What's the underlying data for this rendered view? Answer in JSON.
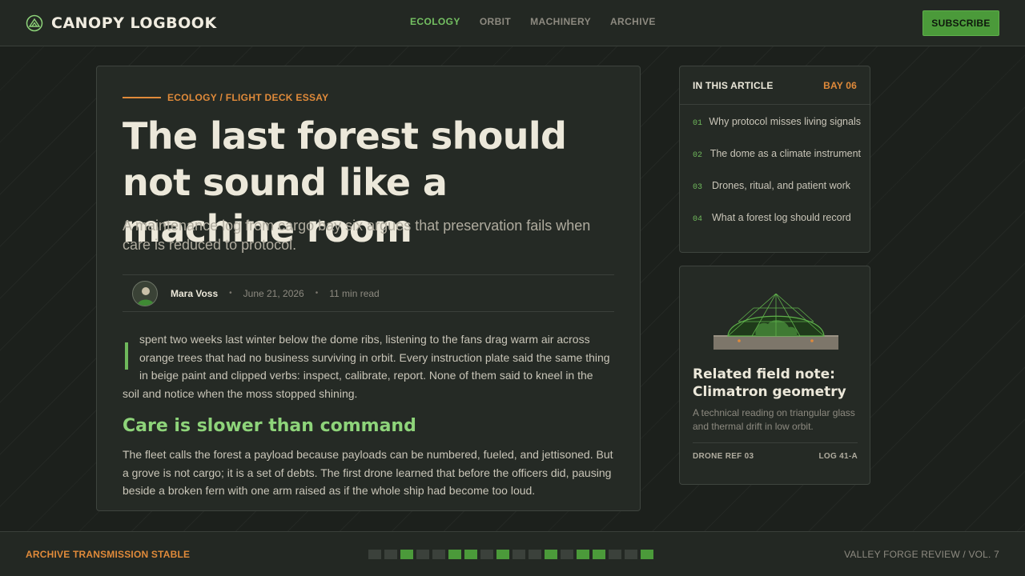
{
  "header": {
    "brand": "CANOPY LOGBOOK",
    "brand_icon": "canopy-logo-icon",
    "nav": [
      {
        "label": "ECOLOGY",
        "active": true
      },
      {
        "label": "ORBIT",
        "active": false
      },
      {
        "label": "MACHINERY",
        "active": false
      },
      {
        "label": "ARCHIVE",
        "active": false
      }
    ],
    "subscribe_label": "SUBSCRIBE"
  },
  "article": {
    "kicker": "ECOLOGY / FLIGHT DECK ESSAY",
    "headline": "The last forest should not sound like a machine room",
    "dek": "A maintenance log from cargo bay six argues that preservation fails when care is reduced to protocol.",
    "author": "Mara Voss",
    "date": "June 21, 2026",
    "read_time": "11 min read",
    "separator": "•",
    "lead_paragraph": "I spent two weeks last winter below the dome ribs, listening to the fans drag warm air across orange trees that had no business surviving in orbit. Every instruction plate said the same thing in beige paint and clipped verbs: inspect, calibrate, report. None of them said to kneel in the soil and notice when the moss stopped shining.",
    "subhead": "Care is slower than command",
    "second_paragraph": "The fleet calls the forest a payload because payloads can be numbered, fueled, and jettisoned. But a grove is not cargo; it is a set of debts. The first drone learned that before the officers did, pausing beside a broken fern with one arm raised as if the whole ship had become too loud."
  },
  "toc": {
    "title": "IN THIS ARTICLE",
    "bay": "BAY 06",
    "items": [
      {
        "num": "01",
        "label": "Why protocol misses living signals"
      },
      {
        "num": "02",
        "label": "The dome as a climate instrument"
      },
      {
        "num": "03",
        "label": "Drones, ritual, and patient work"
      },
      {
        "num": "04",
        "label": "What a forest log should record"
      }
    ]
  },
  "related": {
    "image_icon": "dome-illustration",
    "title": "Related field note: Climatron geometry",
    "description": "A technical reading on triangular glass and thermal drift in low orbit.",
    "ref_left": "DRONE REF 03",
    "ref_right": "LOG 41-A"
  },
  "footer": {
    "status": "ARCHIVE TRANSMISSION STABLE",
    "signal_bars": [
      false,
      false,
      true,
      false,
      false,
      true,
      true,
      false,
      true,
      false,
      false,
      true,
      false,
      true,
      true,
      false,
      false,
      true
    ],
    "credit": "VALLEY FORGE REVIEW / VOL. 7"
  },
  "colors": {
    "accent_green": "#4b9a3a",
    "accent_orange": "#e08a3a",
    "background": "#1c201c",
    "card": "#252a25"
  }
}
